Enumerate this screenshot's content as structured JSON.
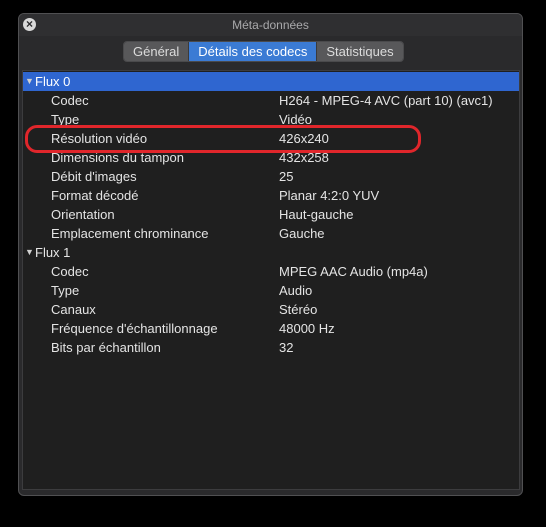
{
  "window": {
    "title": "Méta-données"
  },
  "tabs": [
    {
      "label": "Général",
      "active": false
    },
    {
      "label": "Détails des codecs",
      "active": true
    },
    {
      "label": "Statistiques",
      "active": false
    }
  ],
  "streams": [
    {
      "label": "Flux 0",
      "expanded": true,
      "selected": true,
      "properties": [
        {
          "key": "Codec",
          "value": "H264 - MPEG-4 AVC (part 10) (avc1)"
        },
        {
          "key": "Type",
          "value": "Vidéo"
        },
        {
          "key": "Résolution vidéo",
          "value": "426x240"
        },
        {
          "key": "Dimensions du tampon",
          "value": "432x258"
        },
        {
          "key": "Débit d'images",
          "value": "25"
        },
        {
          "key": "Format décodé",
          "value": "Planar 4:2:0 YUV"
        },
        {
          "key": "Orientation",
          "value": "Haut-gauche"
        },
        {
          "key": "Emplacement chrominance",
          "value": "Gauche"
        }
      ]
    },
    {
      "label": "Flux 1",
      "expanded": true,
      "selected": false,
      "properties": [
        {
          "key": "Codec",
          "value": "MPEG AAC Audio (mp4a)"
        },
        {
          "key": "Type",
          "value": "Audio"
        },
        {
          "key": "Canaux",
          "value": "Stéréo"
        },
        {
          "key": "Fréquence d'échantillonnage",
          "value": "48000 Hz"
        },
        {
          "key": "Bits par échantillon",
          "value": "32"
        }
      ]
    }
  ],
  "colors": {
    "accent": "#2f66d0",
    "annotation": "#e0262b"
  }
}
